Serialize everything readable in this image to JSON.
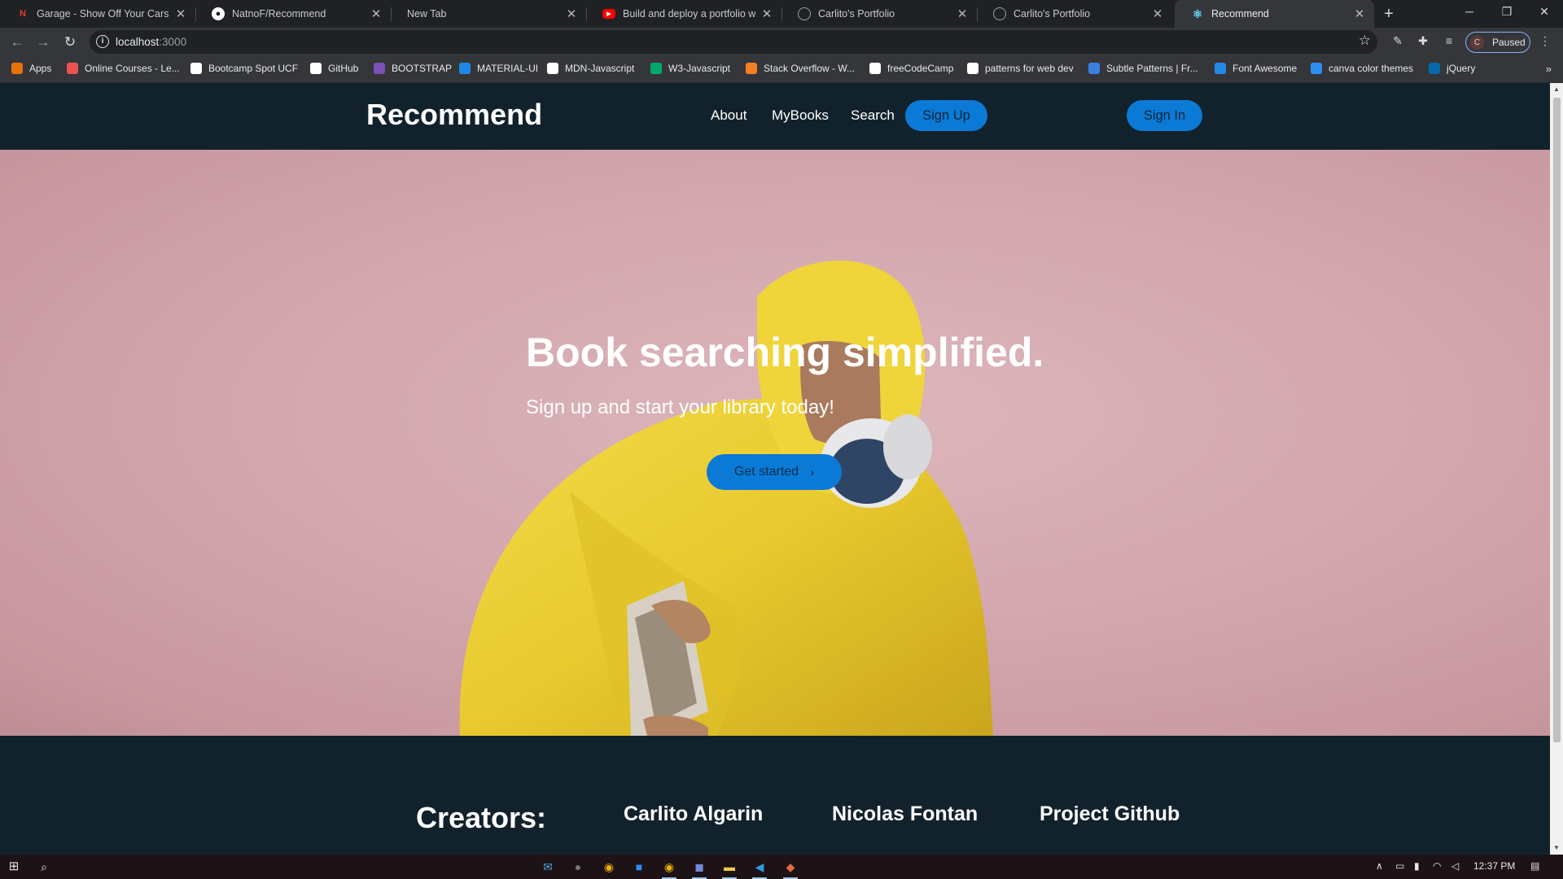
{
  "browser": {
    "tabs": [
      {
        "title": "Garage - Show Off Your Cars | NatnoF",
        "favicon": "N",
        "favicon_color": "#d32f2f"
      },
      {
        "title": "NatnoF/Recommend",
        "favicon": "github",
        "favicon_color": "#ffffff"
      },
      {
        "title": "New Tab",
        "favicon": "",
        "favicon_color": ""
      },
      {
        "title": "Build and deploy a portfolio website",
        "favicon": "youtube",
        "favicon_color": "#ff0000"
      },
      {
        "title": "Carlito's Portfolio",
        "favicon": "globe",
        "favicon_color": "#9aa0a6"
      },
      {
        "title": "Carlito's Portfolio",
        "favicon": "globe",
        "favicon_color": "#9aa0a6"
      },
      {
        "title": "Recommend",
        "favicon": "react",
        "favicon_color": "#61dafb",
        "active": true
      }
    ],
    "new_tab_label": "+",
    "window_controls": {
      "minimize": "─",
      "restore": "❐",
      "close": "✕"
    },
    "address": {
      "host": "localhost",
      "port": ":3000"
    },
    "profile": {
      "initial": "C",
      "status": "Paused"
    },
    "bookmarks": [
      {
        "label": "Apps",
        "icon": "apps-grid-icon",
        "color": "#e8710a"
      },
      {
        "label": "Online Courses - Le...",
        "icon": "udemy-icon",
        "color": "#ec5252"
      },
      {
        "label": "Bootcamp Spot UCF",
        "icon": "bootcamp-icon",
        "color": "#ffffff"
      },
      {
        "label": "GitHub",
        "icon": "github-icon",
        "color": "#ffffff"
      },
      {
        "label": "BOOTSTRAP",
        "icon": "bootstrap-icon",
        "color": "#7952b3"
      },
      {
        "label": "MATERIAL-UI",
        "icon": "material-ui-icon",
        "color": "#1e88e5"
      },
      {
        "label": "MDN-Javascript",
        "icon": "mdn-icon",
        "color": "#ffffff"
      },
      {
        "label": "W3-Javascript",
        "icon": "w3-icon",
        "color": "#04aa6d"
      },
      {
        "label": "Stack Overflow - W...",
        "icon": "stackoverflow-icon",
        "color": "#f48024"
      },
      {
        "label": "freeCodeCamp",
        "icon": "freecodecamp-icon",
        "color": "#ffffff"
      },
      {
        "label": "patterns for web dev",
        "icon": "bs-icon",
        "color": "#ffffff"
      },
      {
        "label": "Subtle Patterns | Fr...",
        "icon": "subtle-patterns-icon",
        "color": "#3d7fe0"
      },
      {
        "label": "Font Awesome",
        "icon": "font-awesome-icon",
        "color": "#228ae6"
      },
      {
        "label": "canva color themes",
        "icon": "canva-icon",
        "color": "#2d8ff0"
      },
      {
        "label": "jQuery",
        "icon": "jquery-icon",
        "color": "#0769ad"
      }
    ]
  },
  "site": {
    "brand": "Recommend",
    "nav": {
      "about": "About",
      "mybooks": "MyBooks",
      "search": "Search",
      "signup": "Sign Up",
      "signin": "Sign In"
    },
    "hero": {
      "title": "Book searching simplified.",
      "subtitle": "Sign up and start your library today!",
      "cta": "Get started",
      "cta_icon": "chevron-right-icon"
    },
    "footer": {
      "heading": "Creators:",
      "names": [
        "Carlito Algarin",
        "Nicolas Fontan"
      ],
      "github": "Project Github"
    },
    "colors": {
      "navbar": "#12222c",
      "accent": "#0b7ad6",
      "hero_bg": "#d3a8ae"
    }
  },
  "taskbar": {
    "clock": "12:37 PM",
    "apps": [
      "mail-icon",
      "cortana-icon",
      "chrome-icon",
      "zoom-icon",
      "chrome-active-icon",
      "discord-icon",
      "file-explorer-icon",
      "vscode-icon",
      "git-icon"
    ]
  }
}
